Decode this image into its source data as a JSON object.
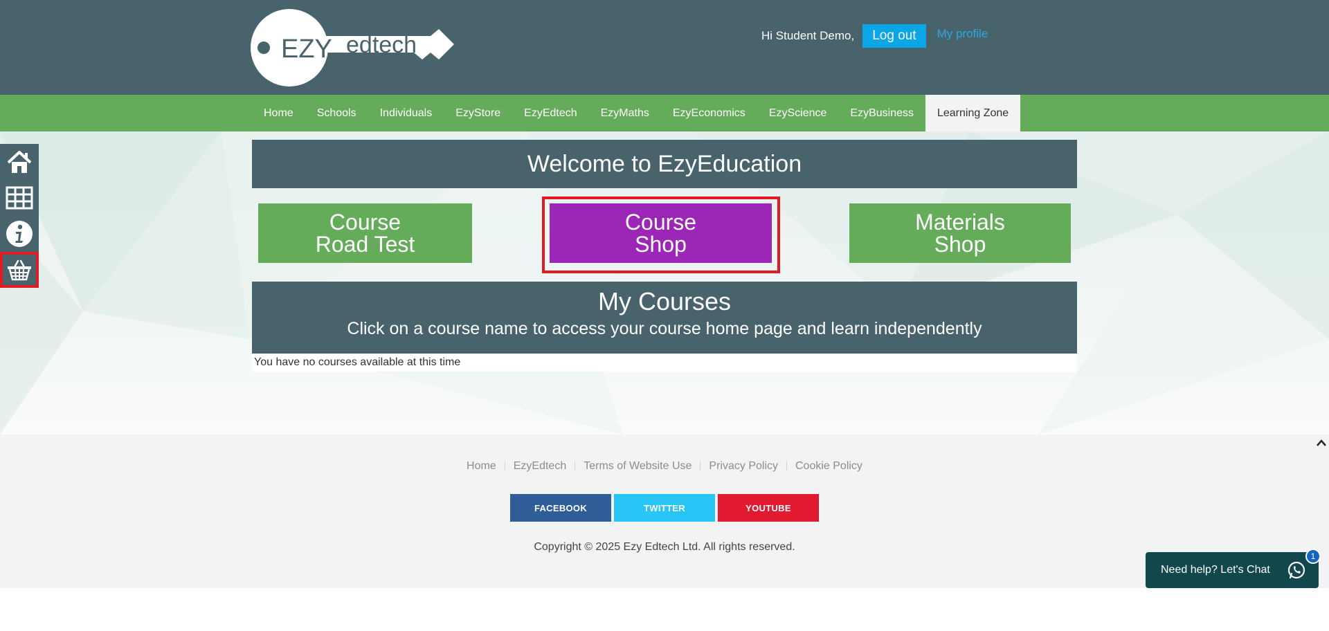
{
  "header": {
    "logo_text_left": "EZY",
    "logo_text_right": "edtech",
    "greeting": "Hi Student Demo,",
    "logout_label": "Log out",
    "profile_label": "My profile"
  },
  "nav": {
    "items": [
      {
        "label": "Home"
      },
      {
        "label": "Schools"
      },
      {
        "label": "Individuals"
      },
      {
        "label": "EzyStore"
      },
      {
        "label": "EzyEdtech"
      },
      {
        "label": "EzyMaths"
      },
      {
        "label": "EzyEconomics"
      },
      {
        "label": "EzyScience"
      },
      {
        "label": "EzyBusiness"
      },
      {
        "label": "Learning Zone"
      }
    ],
    "active": "Learning Zone"
  },
  "sidebar": {
    "icons": [
      "home-icon",
      "grid-icon",
      "info-icon",
      "basket-icon"
    ]
  },
  "main": {
    "welcome": "Welcome to EzyEducation",
    "tiles": [
      {
        "line1": "Course",
        "line2": "Road Test"
      },
      {
        "line1": "Course",
        "line2": "Shop"
      },
      {
        "line1": "Materials",
        "line2": "Shop"
      }
    ],
    "courses_title": "My Courses",
    "courses_subtitle": "Click on a course name to access your course home page and learn independently",
    "no_courses": "You have no courses available at this time"
  },
  "footer": {
    "links": [
      "Home",
      "EzyEdtech",
      "Terms of Website Use",
      "Privacy Policy",
      "Cookie Policy"
    ],
    "social": {
      "facebook": "FACEBOOK",
      "twitter": "TWITTER",
      "youtube": "YOUTUBE"
    },
    "copyright": "Copyright © 2025 Ezy Edtech Ltd. All rights reserved."
  },
  "chat": {
    "label": "Need help? Let's Chat",
    "badge": "1"
  },
  "colors": {
    "header": "#48636b",
    "nav": "#65ac5a",
    "tile_green": "#65ac5a",
    "tile_purple": "#9c27b7",
    "highlight": "#e01b24",
    "logout": "#0aa6e6"
  }
}
